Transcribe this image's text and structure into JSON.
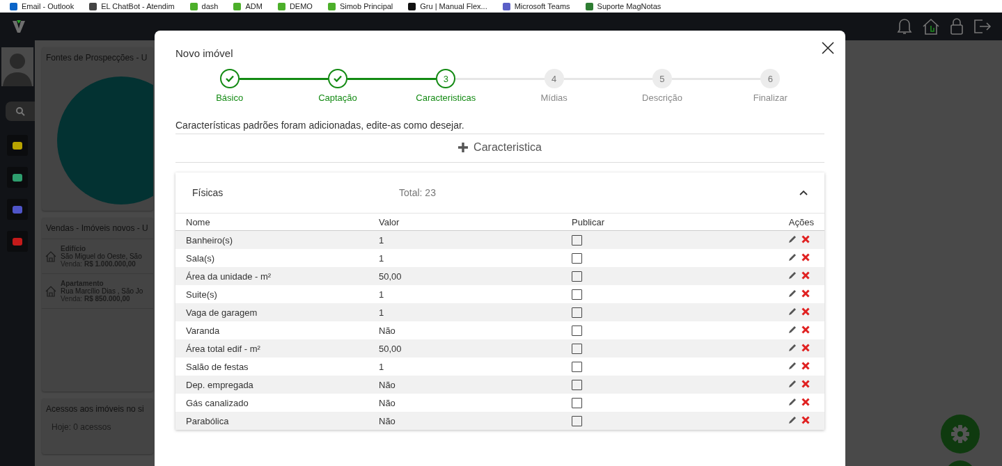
{
  "bookmarks": [
    {
      "label": "Email - Outlook",
      "color": "#0a64c8"
    },
    {
      "label": "EL ChatBot - Atendim",
      "color": "#444444"
    },
    {
      "label": "dash",
      "color": "#4caf2a"
    },
    {
      "label": "ADM",
      "color": "#4caf2a"
    },
    {
      "label": "DEMO",
      "color": "#4caf2a"
    },
    {
      "label": "Simob Principal",
      "color": "#4caf2a"
    },
    {
      "label": "Gru | Manual Flex...",
      "color": "#111111"
    },
    {
      "label": "Microsoft Teams",
      "color": "#5b5fc7"
    },
    {
      "label": "Suporte MagNotas",
      "color": "#2e7d32"
    }
  ],
  "sidebar": {
    "items": [
      {
        "color": "#b8a300"
      },
      {
        "color": "#2e9e6e"
      },
      {
        "color": "#4f55c8"
      },
      {
        "color": "#c41a1a"
      }
    ]
  },
  "dashboard": {
    "prospect_card": {
      "title": "Fontes de Prospecções - U"
    },
    "sales_card": {
      "title": "Vendas - Imóveis novos - U",
      "listings": [
        {
          "type": "Edifício",
          "address": "São Miguel do Oeste, São",
          "price_label": "Venda:",
          "price": "R$  1.000.000,00"
        },
        {
          "type": "Apartamento",
          "address": "Rua Marcílio Dias , São Jo",
          "price_label": "Venda:",
          "price": "R$  850.000,00"
        }
      ]
    },
    "access_card": {
      "title": "Acessos aos imóveis no si",
      "today_label": "Hoje:",
      "today_value": "0 acessos"
    }
  },
  "modal": {
    "title": "Novo imóvel",
    "steps": [
      {
        "label": "Básico",
        "completed": true,
        "current": false
      },
      {
        "label": "Captação",
        "completed": true,
        "current": false
      },
      {
        "number": "3",
        "label": "Caracteristicas",
        "completed": false,
        "current": true
      },
      {
        "number": "4",
        "label": "Mídias",
        "completed": false,
        "current": false
      },
      {
        "number": "5",
        "label": "Descrição",
        "completed": false,
        "current": false
      },
      {
        "number": "6",
        "label": "Finalizar",
        "completed": false,
        "current": false
      }
    ],
    "info": "Características padrões foram adicionadas, edite-as como desejar.",
    "add_button": "Caracteristica",
    "section": {
      "title": "Físicas",
      "total": "Total: 23",
      "expanded": true,
      "columns": [
        "Nome",
        "Valor",
        "Publicar",
        "Ações"
      ],
      "rows": [
        {
          "name": "Banheiro(s)",
          "value": "1",
          "published": false
        },
        {
          "name": "Sala(s)",
          "value": "1",
          "published": false
        },
        {
          "name": "Área da unidade - m²",
          "value": "50,00",
          "published": false
        },
        {
          "name": "Suite(s)",
          "value": "1",
          "published": false
        },
        {
          "name": "Vaga de garagem",
          "value": "1",
          "published": false
        },
        {
          "name": "Varanda",
          "value": "Não",
          "published": false
        },
        {
          "name": "Área total edif - m²",
          "value": "50,00",
          "published": false
        },
        {
          "name": "Salão de festas",
          "value": "1",
          "published": false
        },
        {
          "name": "Dep. empregada",
          "value": "Não",
          "published": false
        },
        {
          "name": "Gás canalizado",
          "value": "Não",
          "published": false
        },
        {
          "name": "Parabólica",
          "value": "Não",
          "published": false
        }
      ]
    }
  }
}
